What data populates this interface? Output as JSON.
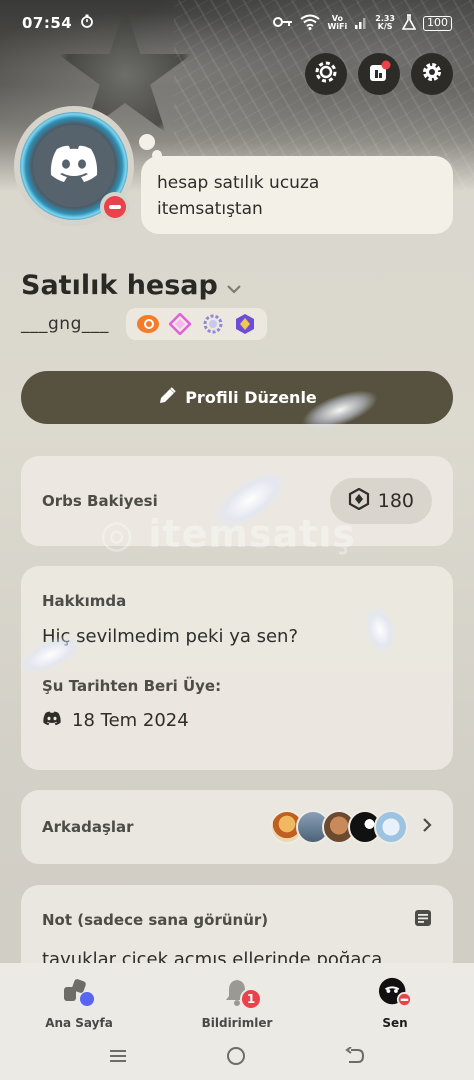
{
  "status_bar": {
    "time": "07:54",
    "vowifi_top": "Vo",
    "vowifi_bottom": "WiFi",
    "speed_value": "2.33",
    "speed_unit": "K/S",
    "battery": "100"
  },
  "profile": {
    "status_message_line1": "hesap satılık ucuza",
    "status_message_line2": "itemsatıştan",
    "display_name": "Satılık hesap",
    "username": "___gng___",
    "edit_button_label": "Profili Düzenle"
  },
  "orbs": {
    "label": "Orbs Bakiyesi",
    "balance": "180"
  },
  "about": {
    "title": "Hakkımda",
    "text": "Hiç sevilmedim peki ya sen?",
    "member_since_label": "Şu Tarihten Beri Üye:",
    "member_since_date": "18 Tem 2024"
  },
  "friends": {
    "label": "Arkadaşlar"
  },
  "note": {
    "title": "Not (sadece sana görünür)",
    "text": "tavuklar çiçek açmış ellerinde poğaça"
  },
  "watermark": "itemsatış",
  "bottom_nav": {
    "home_label": "Ana Sayfa",
    "notifications_label": "Bildirimler",
    "notifications_count": "1",
    "you_label": "Sen"
  },
  "colors": {
    "accent_button": "#57523f",
    "dnd_red": "#e8424a",
    "home_dot": "#5865f2"
  }
}
